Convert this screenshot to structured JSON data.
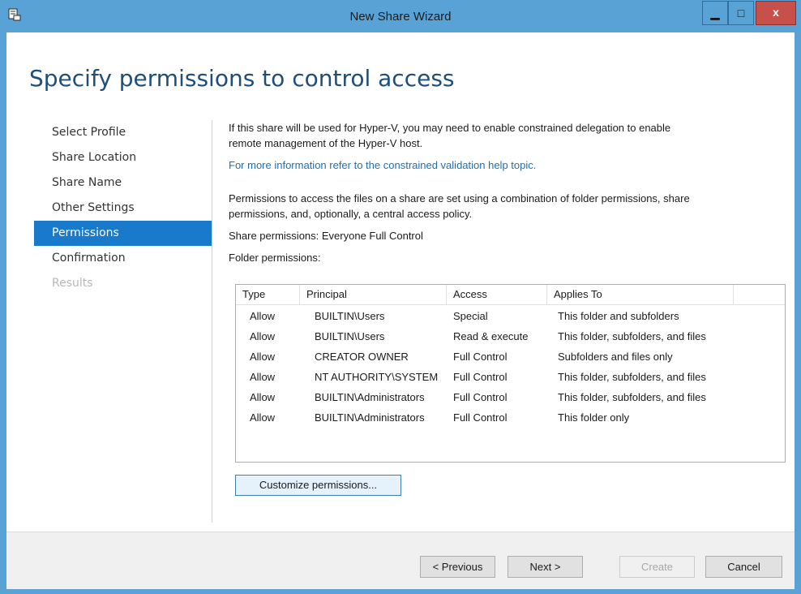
{
  "window": {
    "title": "New Share Wizard",
    "icons": {
      "app": "share-wizard-icon",
      "minimize": "minimize-icon",
      "maximize": "maximize-icon",
      "close": "close-icon"
    },
    "buttons": {
      "minimize": "▁",
      "maximize": "□",
      "close": "x"
    }
  },
  "page": {
    "heading": "Specify permissions to control access"
  },
  "nav": {
    "items": [
      {
        "label": "Select Profile",
        "state": "normal"
      },
      {
        "label": "Share Location",
        "state": "normal"
      },
      {
        "label": "Share Name",
        "state": "normal"
      },
      {
        "label": "Other Settings",
        "state": "normal"
      },
      {
        "label": "Permissions",
        "state": "active"
      },
      {
        "label": "Confirmation",
        "state": "normal"
      },
      {
        "label": "Results",
        "state": "disabled"
      }
    ]
  },
  "main": {
    "hyperv_line1": "If this share will be used for Hyper-V, you may need to enable constrained delegation to enable",
    "hyperv_line2": "remote management of the Hyper-V host.",
    "help_link": "For more information refer to the constrained validation help topic.",
    "perm_line1": "Permissions to access the files on a share are set using a combination of folder permissions, share",
    "perm_line2": "permissions, and, optionally, a central access policy.",
    "share_permissions": "Share permissions: Everyone Full Control",
    "folder_permissions_label": "Folder permissions:"
  },
  "table": {
    "columns": [
      "Type",
      "Principal",
      "Access",
      "Applies To"
    ],
    "rows": [
      [
        "Allow",
        "BUILTIN\\Users",
        "Special",
        "This folder and subfolders"
      ],
      [
        "Allow",
        "BUILTIN\\Users",
        "Read & execute",
        "This folder, subfolders, and files"
      ],
      [
        "Allow",
        "CREATOR OWNER",
        "Full Control",
        "Subfolders and files only"
      ],
      [
        "Allow",
        "NT AUTHORITY\\SYSTEM",
        "Full Control",
        "This folder, subfolders, and files"
      ],
      [
        "Allow",
        "BUILTIN\\Administrators",
        "Full Control",
        "This folder, subfolders, and files"
      ],
      [
        "Allow",
        "BUILTIN\\Administrators",
        "Full Control",
        "This folder only"
      ]
    ]
  },
  "buttons": {
    "customize": "Customize permissions...",
    "previous": "< Previous",
    "next": "Next >",
    "create": "Create",
    "cancel": "Cancel"
  },
  "colors": {
    "frame": "#58a2d6",
    "heading": "#1e4e79",
    "nav_active": "#1979ca",
    "link": "#1e6fb2",
    "close_button": "#c7504b"
  }
}
